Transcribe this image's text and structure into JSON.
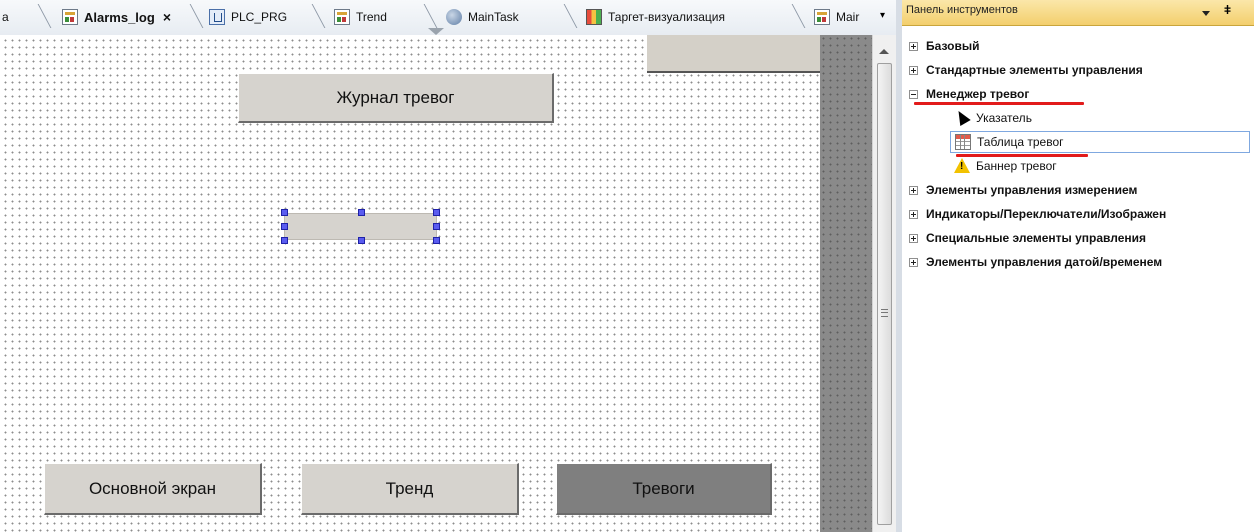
{
  "tabs": {
    "partial_left": "а",
    "alarms_log": "Alarms_log",
    "close_glyph": "×",
    "plc_prg": "PLC_PRG",
    "trend": "Trend",
    "main_task": "MainTask",
    "target_vis": "Таргет-визуализация",
    "main_partial": "Mair",
    "overflow_glyph": "▾"
  },
  "canvas": {
    "title_button": "Журнал тревог",
    "nav_buttons": [
      "Основной экран",
      "Тренд",
      "Тревоги"
    ]
  },
  "toolbox": {
    "title": "Панель инструментов",
    "pin_glyph": "ǂ",
    "groups": [
      "Базовый",
      "Стандартные элементы управления",
      "Менеджер тревог",
      "Элементы управления измерением",
      "Индикаторы/Переключатели/Изображен",
      "Специальные элементы управления",
      "Элементы управления датой/временем"
    ],
    "alarm_items": [
      "Указатель",
      "Таблица тревог",
      "Баннер тревог"
    ],
    "expanded_group": "Менеджер тревог",
    "selected_item": "Таблица тревог"
  },
  "icons": {
    "tab_visualization": "visualization-icon",
    "tab_program": "program-icon",
    "tab_task": "task-icon",
    "tab_target": "target-visualization-icon",
    "pointer": "pointer-arrow-icon",
    "alarm_table": "alarm-table-icon",
    "alarm_banner": "warning-icon"
  },
  "colors": {
    "panel_title_bg": "#f3cf6d",
    "selection_handle": "#5a5cf0",
    "annotation_red": "#e21b1b",
    "active_nav_button": "#7f7f7f"
  }
}
